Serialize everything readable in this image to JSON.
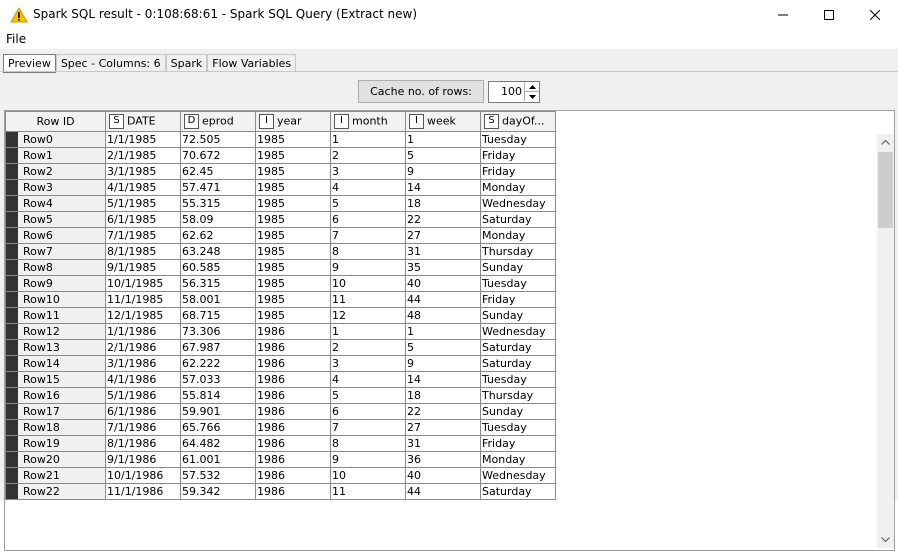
{
  "window": {
    "title": "Spark SQL result - 0:108:68:61 - Spark SQL Query (Extract new)"
  },
  "menu": {
    "file": "File"
  },
  "tabs": [
    "Preview",
    "Spec - Columns: 6",
    "Spark",
    "Flow Variables"
  ],
  "cache": {
    "label": "Cache no. of rows:",
    "value": "100"
  },
  "columns": [
    {
      "name": "Row ID",
      "type": ""
    },
    {
      "name": "DATE",
      "type": "S"
    },
    {
      "name": "eprod",
      "type": "D"
    },
    {
      "name": "year",
      "type": "I"
    },
    {
      "name": "month",
      "type": "I"
    },
    {
      "name": "week",
      "type": "I"
    },
    {
      "name": "dayOf...",
      "type": "S"
    }
  ],
  "rows": [
    [
      "Row0",
      "1/1/1985",
      "72.505",
      "1985",
      "1",
      "1",
      "Tuesday"
    ],
    [
      "Row1",
      "2/1/1985",
      "70.672",
      "1985",
      "2",
      "5",
      "Friday"
    ],
    [
      "Row2",
      "3/1/1985",
      "62.45",
      "1985",
      "3",
      "9",
      "Friday"
    ],
    [
      "Row3",
      "4/1/1985",
      "57.471",
      "1985",
      "4",
      "14",
      "Monday"
    ],
    [
      "Row4",
      "5/1/1985",
      "55.315",
      "1985",
      "5",
      "18",
      "Wednesday"
    ],
    [
      "Row5",
      "6/1/1985",
      "58.09",
      "1985",
      "6",
      "22",
      "Saturday"
    ],
    [
      "Row6",
      "7/1/1985",
      "62.62",
      "1985",
      "7",
      "27",
      "Monday"
    ],
    [
      "Row7",
      "8/1/1985",
      "63.248",
      "1985",
      "8",
      "31",
      "Thursday"
    ],
    [
      "Row8",
      "9/1/1985",
      "60.585",
      "1985",
      "9",
      "35",
      "Sunday"
    ],
    [
      "Row9",
      "10/1/1985",
      "56.315",
      "1985",
      "10",
      "40",
      "Tuesday"
    ],
    [
      "Row10",
      "11/1/1985",
      "58.001",
      "1985",
      "11",
      "44",
      "Friday"
    ],
    [
      "Row11",
      "12/1/1985",
      "68.715",
      "1985",
      "12",
      "48",
      "Sunday"
    ],
    [
      "Row12",
      "1/1/1986",
      "73.306",
      "1986",
      "1",
      "1",
      "Wednesday"
    ],
    [
      "Row13",
      "2/1/1986",
      "67.987",
      "1986",
      "2",
      "5",
      "Saturday"
    ],
    [
      "Row14",
      "3/1/1986",
      "62.222",
      "1986",
      "3",
      "9",
      "Saturday"
    ],
    [
      "Row15",
      "4/1/1986",
      "57.033",
      "1986",
      "4",
      "14",
      "Tuesday"
    ],
    [
      "Row16",
      "5/1/1986",
      "55.814",
      "1986",
      "5",
      "18",
      "Thursday"
    ],
    [
      "Row17",
      "6/1/1986",
      "59.901",
      "1986",
      "6",
      "22",
      "Sunday"
    ],
    [
      "Row18",
      "7/1/1986",
      "65.766",
      "1986",
      "7",
      "27",
      "Tuesday"
    ],
    [
      "Row19",
      "8/1/1986",
      "64.482",
      "1986",
      "8",
      "31",
      "Friday"
    ],
    [
      "Row20",
      "9/1/1986",
      "61.001",
      "1986",
      "9",
      "36",
      "Monday"
    ],
    [
      "Row21",
      "10/1/1986",
      "57.532",
      "1986",
      "10",
      "40",
      "Wednesday"
    ],
    [
      "Row22",
      "11/1/1986",
      "59.342",
      "1986",
      "11",
      "44",
      "Saturday"
    ]
  ],
  "icons": {
    "title": "warning-triangle-icon",
    "minimize": "minimize-icon",
    "maximize": "maximize-icon",
    "close": "close-icon"
  },
  "colors": {
    "warning": "#f5c400",
    "row_marker": "#333333"
  }
}
